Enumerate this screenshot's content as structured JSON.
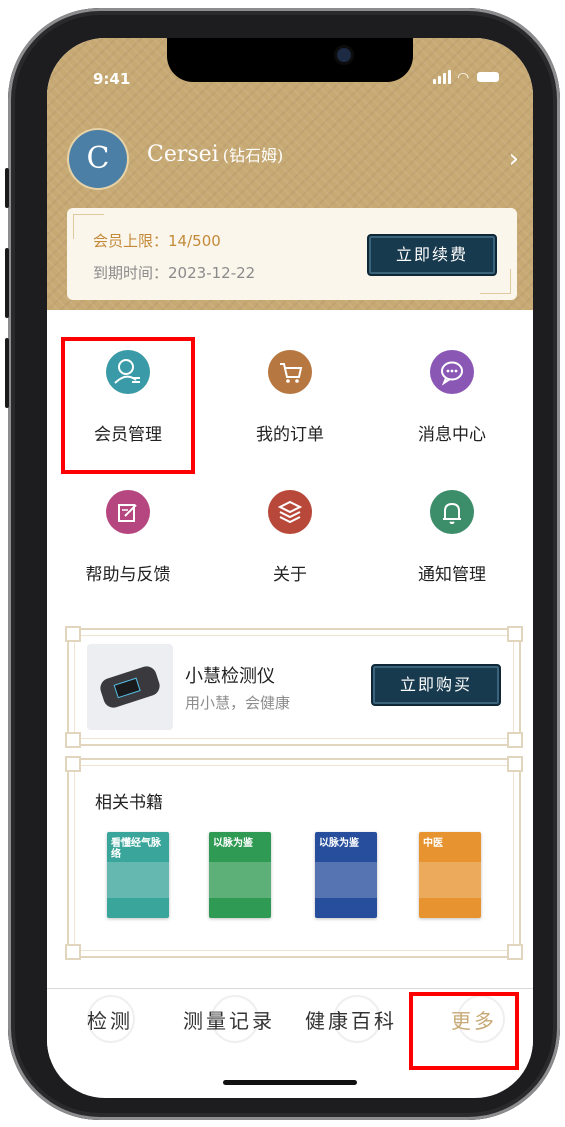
{
  "status_bar": {
    "time": "9:41"
  },
  "profile": {
    "avatar_letter": "C",
    "name": "Cersei",
    "level": "(钻石姆)"
  },
  "membership": {
    "limit_label": "会员上限：",
    "limit_value": "14/500",
    "expire_label": "到期时间：",
    "expire_value": "2023-12-22",
    "renew_label": "立即续费"
  },
  "menu": [
    {
      "label": "会员管理",
      "icon": "member-icon",
      "color": "#3a9aa7"
    },
    {
      "label": "我的订单",
      "icon": "cart-icon",
      "color": "#b77740"
    },
    {
      "label": "消息中心",
      "icon": "message-icon",
      "color": "#8a57b5"
    },
    {
      "label": "帮助与反馈",
      "icon": "feedback-icon",
      "color": "#b5467f"
    },
    {
      "label": "关于",
      "icon": "layers-icon",
      "color": "#b8493a"
    },
    {
      "label": "通知管理",
      "icon": "bell-icon",
      "color": "#3c8d6a"
    }
  ],
  "device": {
    "title": "小慧检测仪",
    "subtitle": "用小慧，会健康",
    "buy_label": "立即购买"
  },
  "books": {
    "title": "相关书籍",
    "items": [
      {
        "cover_text": "看懂经气脉络",
        "color": "#3aa59a"
      },
      {
        "cover_text": "以脉为鉴",
        "color": "#2f9a53"
      },
      {
        "cover_text": "以脉为鉴",
        "color": "#274e9c"
      },
      {
        "cover_text": "中医",
        "color": "#e7932f"
      }
    ]
  },
  "tabbar": [
    {
      "label": "检测"
    },
    {
      "label": "测量记录"
    },
    {
      "label": "健康百科"
    },
    {
      "label": "更多",
      "color": "#c7a974"
    }
  ]
}
